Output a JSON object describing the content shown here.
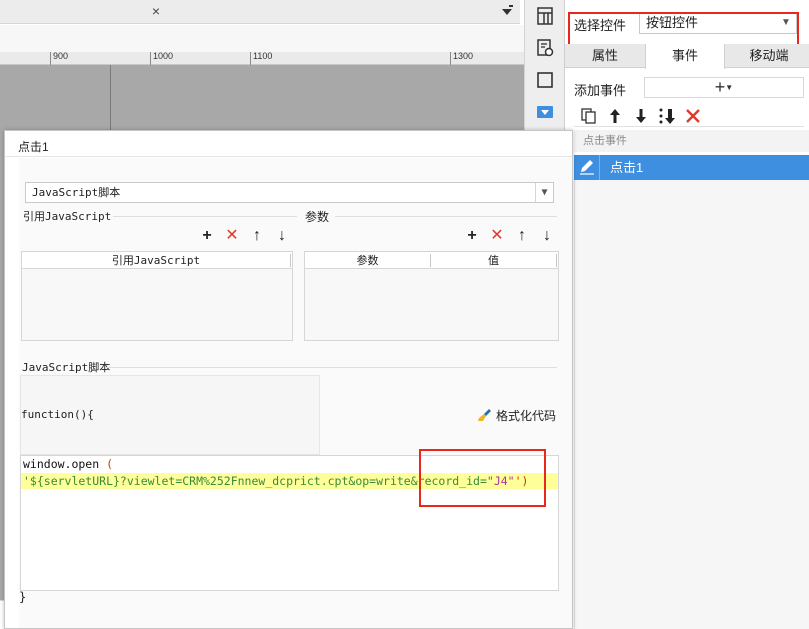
{
  "background_editor": {
    "tab_close": "×",
    "ruler_ticks": [
      "900",
      "1000",
      "1100",
      "1300"
    ]
  },
  "right_panel": {
    "select_label": "选择控件",
    "select_value": "按钮控件",
    "tabs": [
      {
        "label": "属性",
        "active": false
      },
      {
        "label": "事件",
        "active": true
      },
      {
        "label": "移动端",
        "active": false
      }
    ],
    "add_event_label": "添加事件",
    "add_event_plus": "+",
    "event_group": "点击事件",
    "event_item": "点击1"
  },
  "dialog": {
    "title": "点击1",
    "type_value": "JavaScript脚本",
    "ref_section_label": "引用JavaScript",
    "param_section_label": "参数",
    "ref_grid_header": "引用JavaScript",
    "param_grid_headers": [
      "参数",
      "值"
    ],
    "js_section_label": "JavaScript脚本",
    "function_header": "function(){",
    "format_code_label": "格式化代码",
    "code_line1": "window.open ",
    "code_line1_paren": "(",
    "code_line2_a": "'${servletURL}?viewlet=CRM%252Fnnew_dcprict.cpt&op=write&record_id=",
    "code_line2_b": "\"J4\"",
    "code_line2_c": "')",
    "closing_brace": "}"
  },
  "colors": {
    "annotation_red": "#e8281c",
    "selected_blue": "#3f8fe0",
    "code_highlight": "#ffff9a",
    "delete_red": "#e03a2e"
  }
}
